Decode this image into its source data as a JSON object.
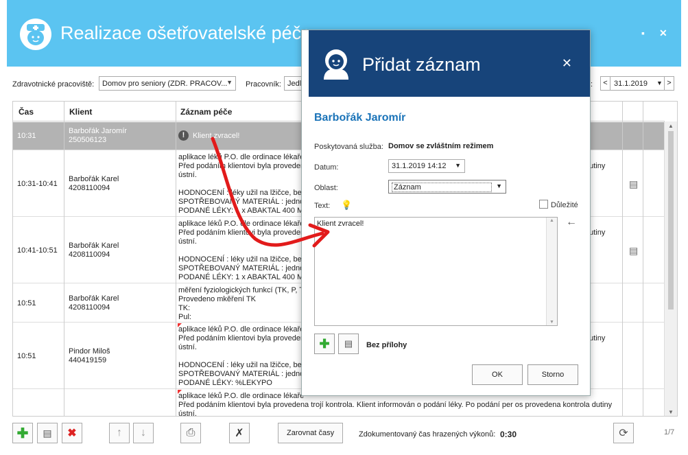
{
  "app": {
    "title": "Realizace ošetřovatelské péče"
  },
  "filters": {
    "workplace_label": "Zdravotnické pracoviště:",
    "workplace_value": "Domov pro seniory (ZDR. PRACOV...",
    "worker_label": "Pracovník:",
    "worker_value": "Jedli",
    "date_suffix": ":",
    "date_value": "31.1.2019",
    "prev": "<",
    "next": ">"
  },
  "grid": {
    "headers": [
      "Čas",
      "Klient",
      "Záznam péče"
    ],
    "rows": [
      {
        "time": "10:31",
        "client_name": "Barbořák Jaromír",
        "client_id": "250506123",
        "record": [
          "Klient zvracel!"
        ],
        "side": ""
      },
      {
        "time": "10:31-10:41",
        "client_name": "Barbořák Karel",
        "client_id": "4208110094",
        "record": [
          "aplikace léků P.O. dle ordinace lékaře",
          "Před podáním klientovi byla provedena",
          "ústní.",
          "",
          "HODNOCENÍ : léky užil na lžičce, bez",
          "SPOTŘEBOVANÝ MATERIÁL : jednorá",
          "PODANÉ LÉKY: 1 x ABAKTAL 400 MG"
        ],
        "side": "dutiny"
      },
      {
        "time": "10:41-10:51",
        "client_name": "Barbořák Karel",
        "client_id": "4208110094",
        "record": [
          "aplikace léků P.O. dle ordinace lékaře",
          "Před podáním klientovi byla provedena",
          "ústní.",
          "",
          "HODNOCENÍ : léky užil na lžičce, bez",
          "SPOTŘEBOVANÝ MATERIÁL : jednorá",
          "PODANÉ LÉKY: 1 x ABAKTAL 400 MG"
        ],
        "side": "dutiny"
      },
      {
        "time": "10:51",
        "client_name": "Barbořák Karel",
        "client_id": "4208110094",
        "record": [
          "měření fyziologických funkcí (TK, P, T",
          "Provedeno mkěření TK",
          "TK:",
          "Pul:"
        ],
        "side": ""
      },
      {
        "time": "10:51",
        "client_name": "Pindor Miloš",
        "client_id": "440419159",
        "record": [
          "aplikace léků P.O. dle ordinace lékaře",
          "Před podáním klientovi byla provedena",
          "ústní.",
          "",
          "HODNOCENÍ : léky užil na lžičce, bez",
          "SPOTŘEBOVANÝ MATERIÁL : jednorá",
          "PODANÉ LÉKY: %LEKYPO"
        ],
        "side": "dutiny"
      },
      {
        "time": "",
        "client_name": "",
        "client_id": "",
        "record": [
          "aplikace léků P.O. dle ordinace lékaře",
          "Před podáním klientovi byla provedena trojí kontrola. Klient informován o podání léky. Po podání per os provedena kontrola dutiny",
          "ústní."
        ],
        "side": ""
      }
    ]
  },
  "bottom": {
    "align_label": "Zarovnat časy",
    "documented_label": "Zdokumentovaný čas hrazených výkonů:",
    "documented_value": "0:30",
    "page": "1/7"
  },
  "modal": {
    "title": "Přidat záznam",
    "client_name": "Barbořák Jaromír",
    "service_label": "Poskytovaná služba:",
    "service_value": "Domov se zvláštním režimem",
    "date_label": "Datum:",
    "date_value": "31.1.2019 14:12",
    "area_label": "Oblast:",
    "area_value": "Záznam",
    "text_label": "Text:",
    "important_label": "Důležité",
    "text_value": "Klient zvracel!",
    "attachment_label": "Bez přílohy",
    "ok": "OK",
    "cancel": "Storno"
  },
  "colors": {
    "titlebar": "#5bc4f1",
    "modal_header": "#17447a",
    "accent": "#1a73b8",
    "arrow": "#e21b1b"
  }
}
